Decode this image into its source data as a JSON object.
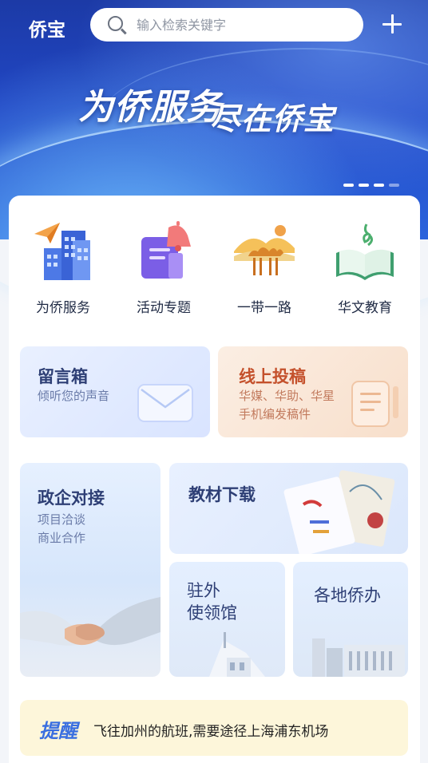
{
  "header": {
    "app_title": "侨宝",
    "search_placeholder": "输入检索关键字",
    "slogan_line1": "为侨服务",
    "slogan_line2": "尽在侨宝",
    "banner_pages": 4,
    "banner_active_page": 1
  },
  "quick_links": [
    {
      "label": "为侨服务",
      "icon": "city-buildings-plane-icon"
    },
    {
      "label": "活动专题",
      "icon": "document-bell-icon"
    },
    {
      "label": "一带一路",
      "icon": "camel-desert-icon"
    },
    {
      "label": "华文教育",
      "icon": "open-book-icon"
    }
  ],
  "tiles": {
    "message_box": {
      "title": "留言箱",
      "subtitle": "倾听您的声音"
    },
    "submit_post": {
      "title": "线上投稿",
      "subtitle_line1": "华媒、华助、华星",
      "subtitle_line2": "手机编发稿件"
    },
    "gov_business": {
      "title": "政企对接",
      "subtitle_line1": "项目洽谈",
      "subtitle_line2": "商业合作"
    },
    "textbook": {
      "title": "教材下载"
    },
    "embassy": {
      "title_line1": "驻外",
      "title_line2": "使领馆"
    },
    "local_office": {
      "title": "各地侨办"
    }
  },
  "notice": {
    "tag": "提醒",
    "message": "飞往加州的航班,需要途径上海浦东机场"
  },
  "colors": {
    "banner_blue": "#2147c5",
    "accent_blue": "#3a6fe0",
    "post_orange": "#c4512c",
    "notice_bg": "#fdf6da"
  }
}
